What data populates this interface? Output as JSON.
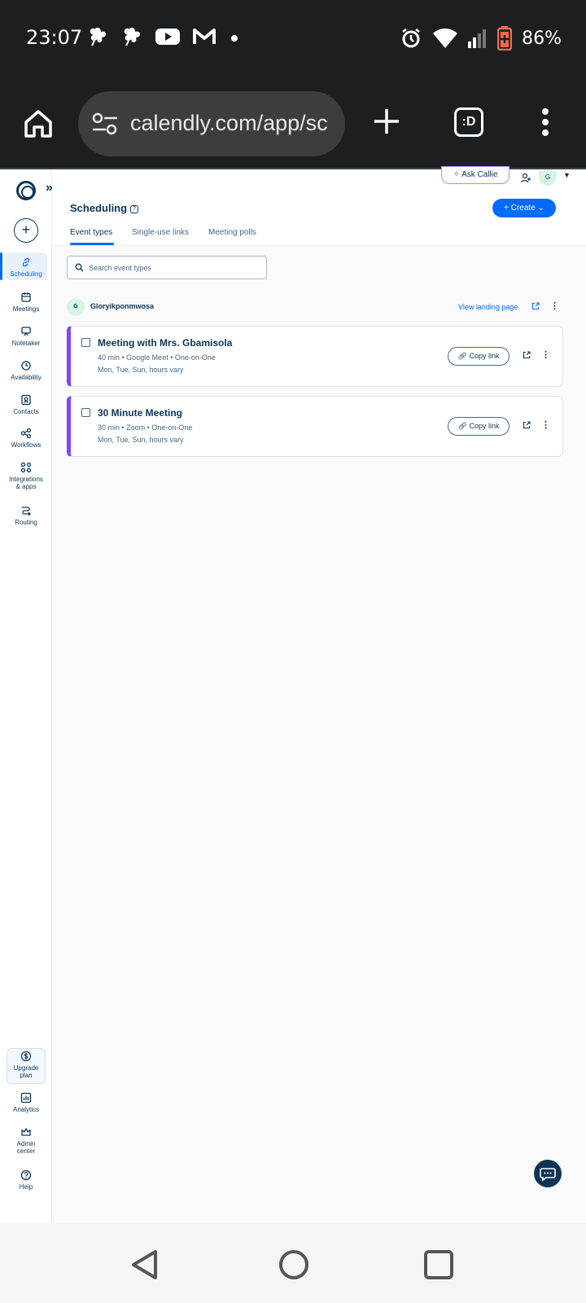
{
  "status_bar": {
    "time": "23:07",
    "battery": "86%",
    "left_icons": [
      "flower-icon",
      "flower-icon",
      "youtube-icon",
      "gmail-icon",
      "dot-icon"
    ],
    "right_icons": [
      "alarm-icon",
      "wifi-icon",
      "signal-icon",
      "battery-icon"
    ]
  },
  "browser": {
    "url": "calendly.com/app/sc",
    "tab_switcher": ":D"
  },
  "sidebar": {
    "expand_glyph": "»",
    "items": [
      {
        "label": "Scheduling",
        "icon": "link-icon",
        "active": true
      },
      {
        "label": "Meetings",
        "icon": "calendar-icon"
      },
      {
        "label": "Notetaker",
        "icon": "notetaker-icon"
      },
      {
        "label": "Availability",
        "icon": "clock-icon"
      },
      {
        "label": "Contacts",
        "icon": "contacts-icon"
      },
      {
        "label": "Workflows",
        "icon": "workflows-icon"
      },
      {
        "label": "Integrations",
        "label2": "& apps",
        "icon": "apps-grid-icon"
      },
      {
        "label": "Routing",
        "icon": "routing-icon"
      }
    ],
    "bottom_items": [
      {
        "label": "Upgrade",
        "label2": "plan",
        "icon": "dollar-icon"
      },
      {
        "label": "Analytics",
        "icon": "analytics-icon"
      },
      {
        "label": "Admin",
        "label2": "center",
        "icon": "crown-icon"
      },
      {
        "label": "Help",
        "icon": "help-icon"
      }
    ]
  },
  "header": {
    "ask_callie": "Ask Callie",
    "avatar_initial": "G",
    "title": "Scheduling",
    "create_label": "Create",
    "tabs": [
      "Event types",
      "Single-use links",
      "Meeting polls"
    ]
  },
  "search": {
    "placeholder": "Search event types"
  },
  "owner": {
    "initial": "G",
    "name": "Gloryikponmwosa",
    "landing_label": "View landing page"
  },
  "events": [
    {
      "title": "Meeting with Mrs. Gbamisola",
      "details": "40 min • Google Meet • One-on-One",
      "schedule": "Mon, Tue, Sun, hours vary",
      "copy_label": "Copy link"
    },
    {
      "title": "30 Minute Meeting",
      "details": "30 min • Zoom • One-on-One",
      "schedule": "Mon, Tue, Sun, hours vary",
      "copy_label": "Copy link"
    }
  ],
  "colors": {
    "primary": "#006bff",
    "event_accent": "#8247f5",
    "text": "#0b3558",
    "muted": "#476788"
  }
}
